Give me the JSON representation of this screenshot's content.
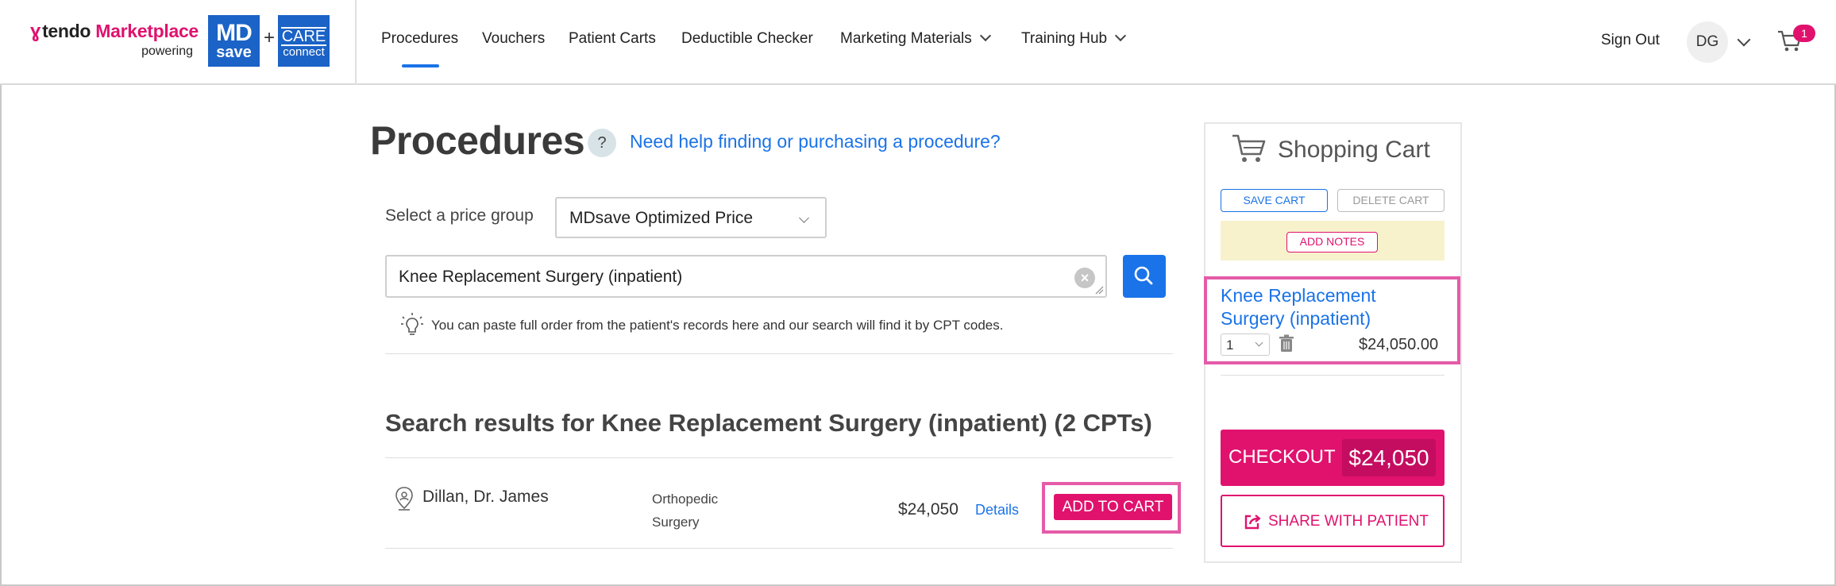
{
  "header": {
    "brand_tendo": "tendo",
    "brand_marketplace": "Marketplace",
    "brand_powering": "powering",
    "mdsave_line1": "MD",
    "mdsave_line2": "save",
    "plus": "+",
    "care_line1": "CARE",
    "care_line2": "connect",
    "nav": [
      {
        "label": "Procedures",
        "active": true
      },
      {
        "label": "Vouchers"
      },
      {
        "label": "Patient Carts"
      },
      {
        "label": "Deductible Checker"
      },
      {
        "label": "Marketing Materials",
        "dropdown": true
      },
      {
        "label": "Training Hub",
        "dropdown": true
      }
    ],
    "sign_out": "Sign Out",
    "avatar_initials": "DG",
    "cart_count": "1"
  },
  "main": {
    "title": "Procedures",
    "help_icon": "?",
    "help_link": "Need help finding or purchasing a procedure?",
    "price_group_label": "Select a price group",
    "price_group_value": "MDsave Optimized Price",
    "search_value": "Knee Replacement Surgery (inpatient)",
    "clear_icon": "×",
    "hint": "You can paste full order from the patient's records here and our search will find it by CPT codes.",
    "results_title": "Search results for Knee Replacement Surgery (inpatient) (2 CPTs)",
    "results": [
      {
        "provider": "Dillan, Dr. James",
        "specialty": "Orthopedic Surgery",
        "price": "$24,050",
        "details": "Details",
        "add_to_cart": "ADD TO CART"
      }
    ]
  },
  "cart": {
    "title": "Shopping Cart",
    "save_cart": "SAVE CART",
    "delete_cart": "DELETE CART",
    "add_notes": "ADD NOTES",
    "items": [
      {
        "name": "Knee Replacement Surgery (inpatient)",
        "qty": "1",
        "price": "$24,050.00"
      }
    ],
    "checkout_label": "CHECKOUT",
    "checkout_amount": "$24,050",
    "share_label": "SHARE WITH PATIENT"
  },
  "colors": {
    "brand_pink": "#e0126e",
    "link_blue": "#1a73e8",
    "mdsave_blue": "#1b63c6",
    "highlight_pink": "#e45ba8",
    "notes_yellow": "#f7f2cc"
  },
  "icons": [
    "tendo-logo-icon",
    "chevron-down-icon",
    "cart-icon",
    "help-icon",
    "clear-icon",
    "search-icon",
    "lightbulb-icon",
    "location-pin-icon",
    "trash-icon",
    "share-icon"
  ]
}
